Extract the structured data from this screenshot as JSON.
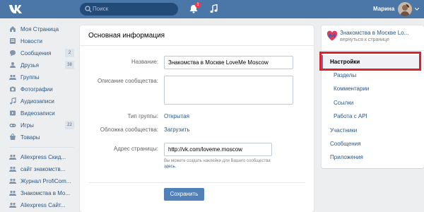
{
  "topbar": {
    "search_placeholder": "Поиск",
    "notifications_count": "1",
    "user_name": "Марина",
    "brand_color": "#4a76a8"
  },
  "menu": {
    "items": [
      {
        "label": "Моя Страница",
        "icon": "home-icon",
        "count": ""
      },
      {
        "label": "Новости",
        "icon": "news-icon",
        "count": ""
      },
      {
        "label": "Сообщения",
        "icon": "messages-icon",
        "count": "2"
      },
      {
        "label": "Друзья",
        "icon": "friends-icon",
        "count": "38"
      },
      {
        "label": "Группы",
        "icon": "groups-icon",
        "count": ""
      },
      {
        "label": "Фотографии",
        "icon": "camera-icon",
        "count": ""
      },
      {
        "label": "Аудиозаписи",
        "icon": "music-icon",
        "count": ""
      },
      {
        "label": "Видеозаписи",
        "icon": "video-icon",
        "count": ""
      },
      {
        "label": "Игры",
        "icon": "games-icon",
        "count": "22"
      },
      {
        "label": "Товары",
        "icon": "shop-icon",
        "count": ""
      }
    ],
    "communities": [
      {
        "label": "Aliexpress Скид..."
      },
      {
        "label": "сайт знакомств..."
      },
      {
        "label": "Журнал ProfiCom..."
      },
      {
        "label": "Знакомства в Мо..."
      },
      {
        "label": "Aliexpress Сайт..."
      }
    ]
  },
  "main": {
    "title": "Основная информация",
    "name_label": "Название:",
    "name_value": "Знакомства в Москве LoveMe Moscow",
    "description_label": "Описание сообщества:",
    "description_value": "",
    "group_type_label": "Тип группы:",
    "group_type_value": "Открытая",
    "cover_label": "Обложка сообщества:",
    "cover_value": "Загрузить",
    "address_label": "Адрес страницы:",
    "address_value": "http://vk.com/loveme.moscow",
    "address_hint": "Вы можете создать наклейки для Вашего сообщества",
    "address_hint_link": "здесь.",
    "save_label": "Сохранить"
  },
  "right": {
    "community_name": "Знакомства в Москве Lo...",
    "back_link": "вернуться к странице",
    "nav": [
      {
        "label": "Настройки",
        "active": true,
        "level": "top"
      },
      {
        "label": "Разделы",
        "active": false,
        "level": "sub"
      },
      {
        "label": "Комментарии",
        "active": false,
        "level": "sub"
      },
      {
        "label": "Ссылки",
        "active": false,
        "level": "sub"
      },
      {
        "label": "Работа с API",
        "active": false,
        "level": "sub"
      },
      {
        "label": "Участники",
        "active": false,
        "level": "top"
      },
      {
        "label": "Сообщения",
        "active": false,
        "level": "top"
      },
      {
        "label": "Приложения",
        "active": false,
        "level": "top"
      }
    ],
    "highlight_color": "#d9232e"
  }
}
